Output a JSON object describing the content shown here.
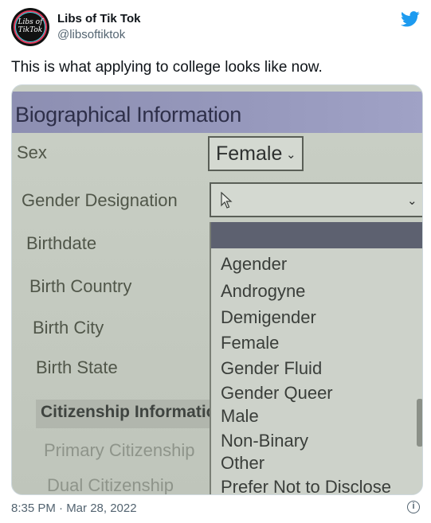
{
  "tweet": {
    "display_name": "Libs of Tik Tok",
    "handle": "@libsoftiktok",
    "avatar_text": "Libs of TikTok",
    "text": "This is what applying to college looks like now.",
    "timestamp": "8:35 PM · Mar 28, 2022",
    "icons": {
      "platform": "twitter-bird-icon",
      "info": "info-icon"
    },
    "colors": {
      "brand": "#1d9bf0",
      "text": "#0f1419",
      "muted": "#536471"
    }
  },
  "photo": {
    "section_title": "Biographical Information",
    "labels": {
      "sex": "Sex",
      "gender_designation": "Gender Designation",
      "birthdate": "Birthdate",
      "birth_country": "Birth Country",
      "birth_city": "Birth City",
      "birth_state": "Birth State"
    },
    "sex_select": {
      "value": "Female"
    },
    "gender_select": {
      "value": ""
    },
    "gender_options": [
      "Agender",
      "Androgyne",
      "Demigender",
      "Female",
      "Gender Fluid",
      "Gender Queer",
      "Male",
      "Non-Binary",
      "Other",
      "Prefer Not to Disclose"
    ],
    "citizenship": {
      "title": "Citizenship Informatio",
      "primary": "Primary Citizenship",
      "dual": "Dual Citizenship"
    }
  }
}
